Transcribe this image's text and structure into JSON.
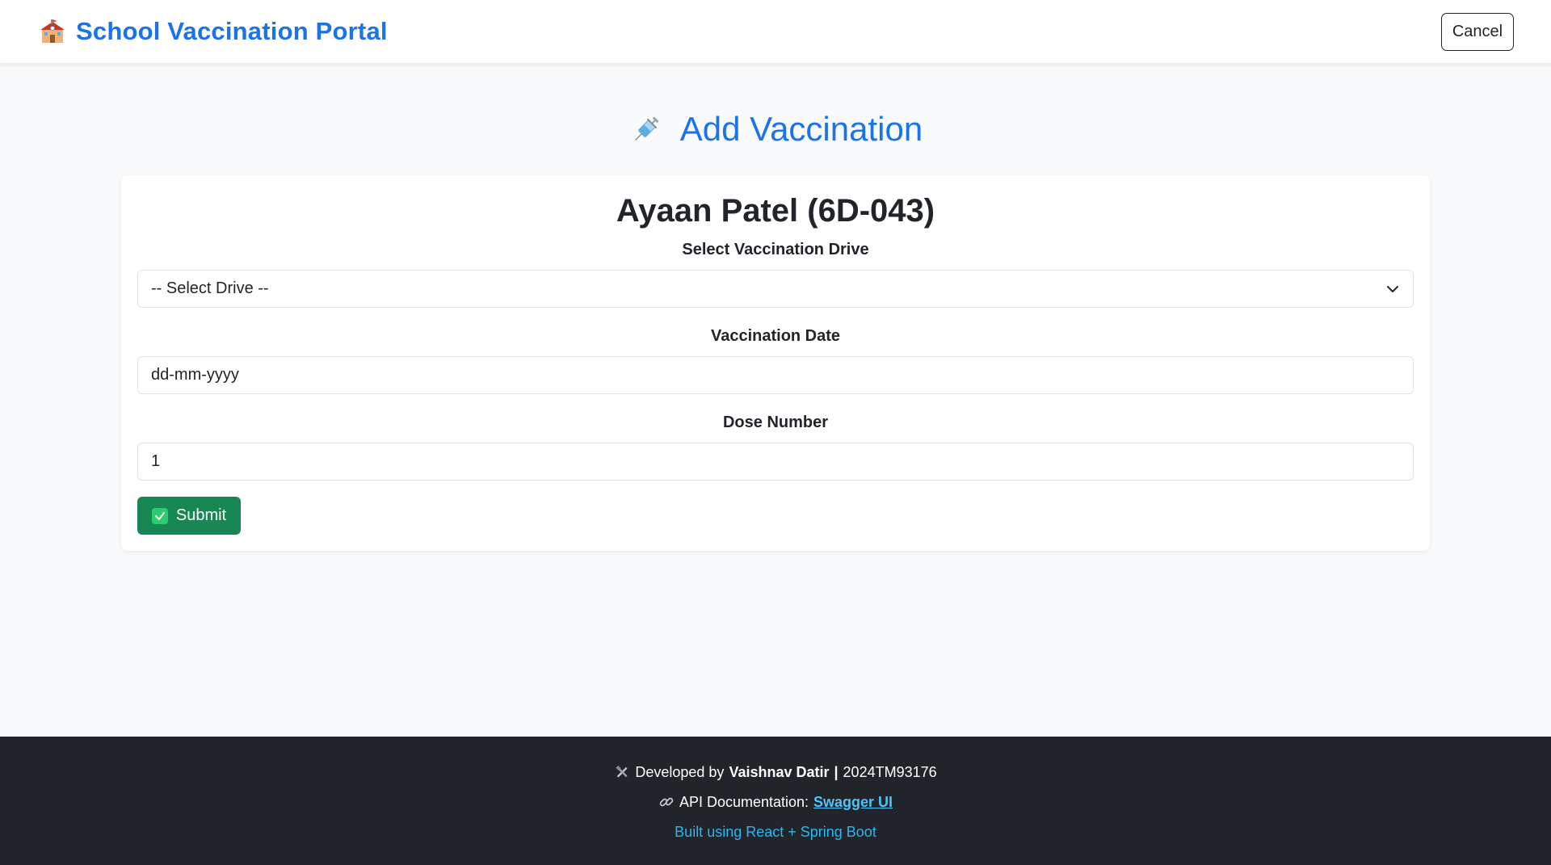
{
  "navbar": {
    "brand_icon": "school-icon",
    "brand_title": "School Vaccination Portal",
    "cancel_label": "Cancel"
  },
  "main": {
    "title_icon": "syringe-icon",
    "title": "Add Vaccination",
    "student_name": "Ayaan Patel (6D-043)",
    "drive_label": "Select Vaccination Drive",
    "drive_selected": "-- Select Drive --",
    "date_label": "Vaccination Date",
    "date_placeholder": "dd-mm-yyyy",
    "dose_label": "Dose Number",
    "dose_value": "1",
    "submit_label": "Submit"
  },
  "footer": {
    "dev_prefix": "Developed by",
    "dev_name": "Vaishnav Datir",
    "dev_sep": "|",
    "dev_id": "2024TM93176",
    "api_prefix": "API Documentation:",
    "api_link": "Swagger UI",
    "built_with": "Built using React + Spring Boot"
  },
  "colors": {
    "accent": "#1a73e8",
    "submit": "#198754",
    "footer_bg": "#212529",
    "link": "#4fc3f7"
  }
}
